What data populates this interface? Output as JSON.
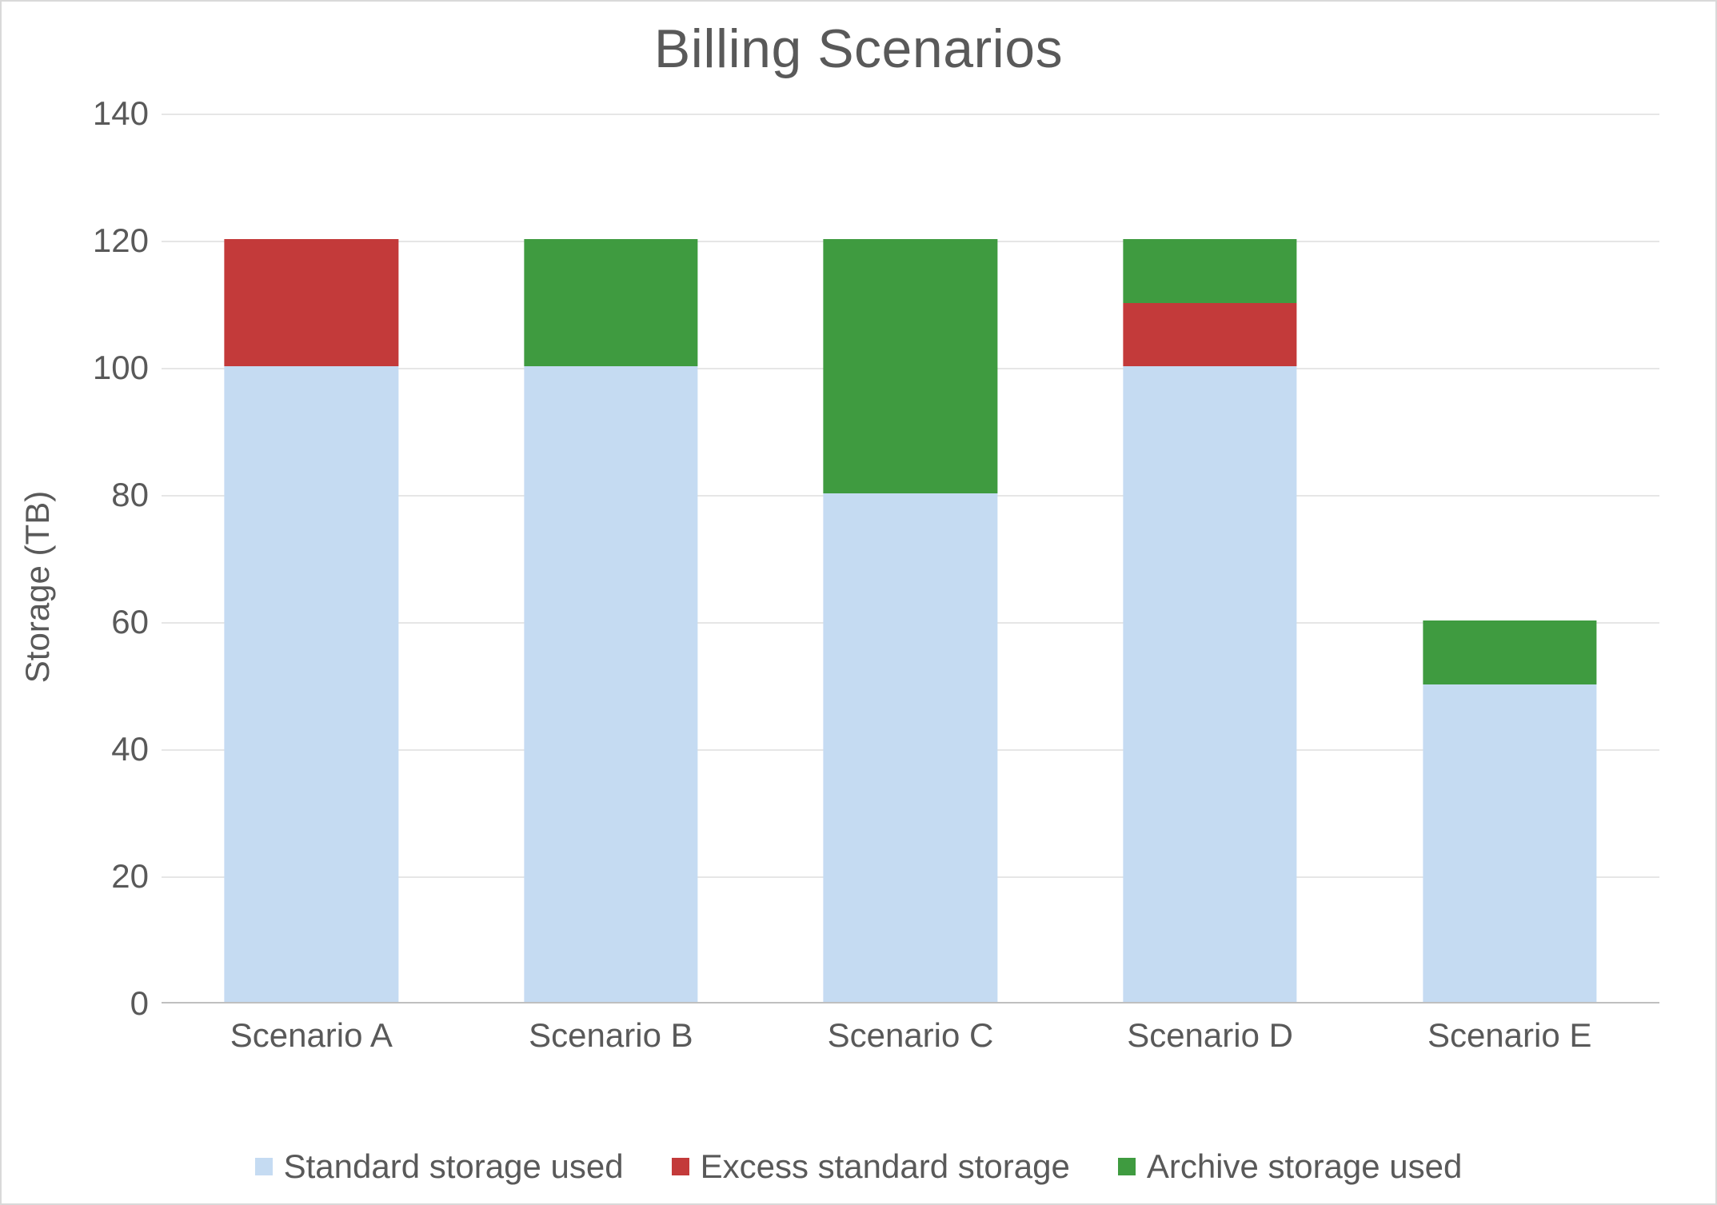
{
  "chart_data": {
    "type": "bar",
    "stacked": true,
    "title": "Billing Scenarios",
    "ylabel": "Storage (TB)",
    "xlabel": "",
    "ylim": [
      0,
      140
    ],
    "ytick_interval": 20,
    "categories": [
      "Scenario A",
      "Scenario B",
      "Scenario C",
      "Scenario D",
      "Scenario E"
    ],
    "series": [
      {
        "name": "Standard storage used",
        "color": "#c5dbf2",
        "values": [
          100,
          100,
          80,
          100,
          50
        ]
      },
      {
        "name": "Excess standard storage",
        "color": "#c33a3a",
        "values": [
          20,
          0,
          0,
          10,
          0
        ]
      },
      {
        "name": "Archive storage used",
        "color": "#3f9b40",
        "values": [
          0,
          20,
          40,
          10,
          10
        ]
      }
    ],
    "legend_position": "bottom",
    "grid": true
  }
}
